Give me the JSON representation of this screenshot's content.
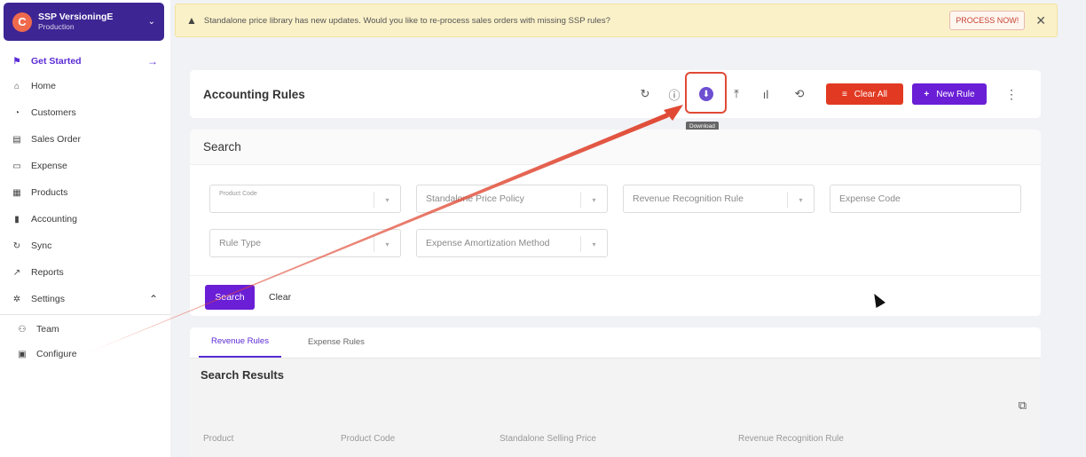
{
  "workspace": {
    "name": "SSP VersioningE",
    "env": "Production",
    "logo_letter": "C"
  },
  "sidebar": {
    "items": [
      {
        "label": "Get Started",
        "icon": "flag-icon",
        "active": true
      },
      {
        "label": "Home",
        "icon": "home-icon"
      },
      {
        "label": "Customers",
        "icon": "customers-icon"
      },
      {
        "label": "Sales Order",
        "icon": "sales-order-icon"
      },
      {
        "label": "Expense",
        "icon": "expense-icon"
      },
      {
        "label": "Products",
        "icon": "products-icon"
      },
      {
        "label": "Accounting",
        "icon": "accounting-icon"
      },
      {
        "label": "Sync",
        "icon": "sync-icon"
      },
      {
        "label": "Reports",
        "icon": "reports-icon"
      },
      {
        "label": "Settings",
        "icon": "settings-icon"
      }
    ],
    "sub_items": [
      {
        "label": "Team",
        "icon": "team-icon"
      },
      {
        "label": "Configure",
        "icon": "configure-icon"
      }
    ]
  },
  "banner": {
    "message": "Standalone price library has new updates. Would you like to re-process sales orders with missing SSP rules?",
    "action": "PROCESS NOW!"
  },
  "header": {
    "title": "Accounting Rules",
    "tooltip": "Download",
    "clear_all": "Clear All",
    "new_rule": "New Rule"
  },
  "search": {
    "title": "Search",
    "fields": {
      "product_code_label": "Product Code",
      "ssp_policy": "Standalone Price Policy",
      "rev_rule": "Revenue Recognition Rule",
      "expense_code": "Expense Code",
      "rule_type": "Rule Type",
      "amort_method": "Expense Amortization Method"
    },
    "search_btn": "Search",
    "clear_btn": "Clear"
  },
  "results": {
    "tabs": [
      "Revenue Rules",
      "Expense Rules"
    ],
    "title": "Search Results",
    "columns": [
      "Product",
      "Product Code",
      "Standalone Selling Price",
      "Revenue Recognition Rule"
    ]
  },
  "colors": {
    "brand": "#5a2bd6",
    "danger": "#e23a22",
    "annotation": "#e04a35"
  }
}
